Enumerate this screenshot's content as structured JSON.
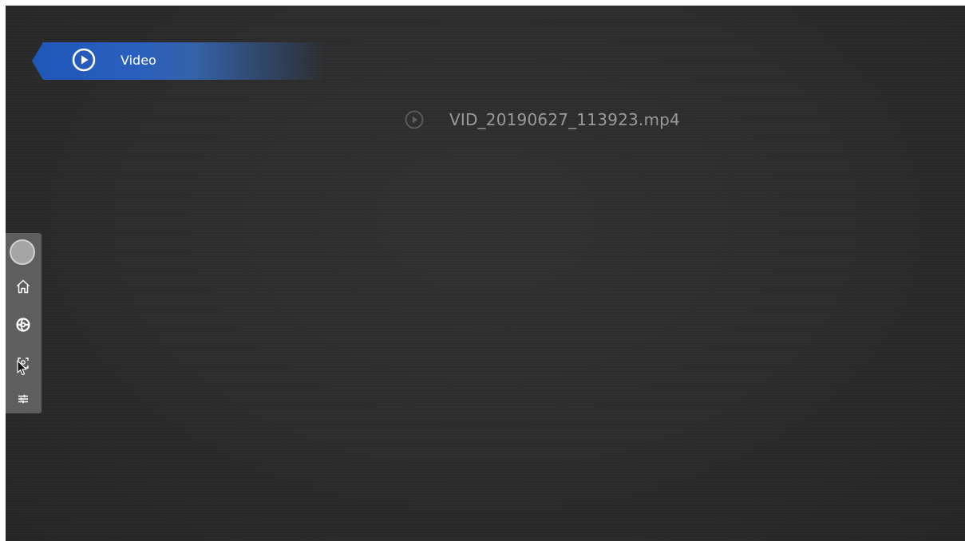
{
  "category": {
    "label": "Video",
    "icon": "play-circle-icon",
    "color": "#1f57b8"
  },
  "files": [
    {
      "name": "VID_20190627_113923.mp4",
      "icon": "play-circle-icon"
    }
  ],
  "toolbar": {
    "items": [
      {
        "name": "floating-menu-handle"
      },
      {
        "icon": "home-icon"
      },
      {
        "icon": "browser-icon"
      },
      {
        "icon": "screenshot-icon"
      },
      {
        "icon": "sliders-icon"
      }
    ]
  }
}
